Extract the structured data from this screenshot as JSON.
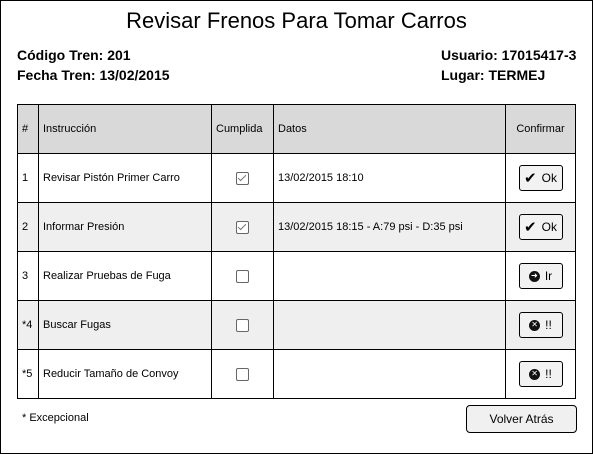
{
  "title": "Revisar Frenos Para Tomar Carros",
  "info": {
    "codigo_tren": "Código Tren: 201",
    "fecha_tren": "Fecha Tren: 13/02/2015",
    "usuario": "Usuario: 17015417-3",
    "lugar": "Lugar: TERMEJ"
  },
  "table": {
    "headers": [
      "#",
      "Instrucción",
      "Cumplida",
      "Datos",
      "Confirmar"
    ],
    "rows": [
      {
        "num": "1",
        "instruccion": "Revisar Pistón Primer Carro",
        "cumplida": true,
        "datos": "13/02/2015 18:10",
        "button": {
          "label": "Ok",
          "icon": "check-icon"
        }
      },
      {
        "num": "2",
        "instruccion": "Informar Presión",
        "cumplida": true,
        "datos": "13/02/2015 18:15 - A:79 psi - D:35 psi",
        "button": {
          "label": "Ok",
          "icon": "check-icon"
        }
      },
      {
        "num": "3",
        "instruccion": "Realizar Pruebas de Fuga",
        "cumplida": false,
        "datos": "",
        "button": {
          "label": "Ir",
          "icon": "arrow-circle-icon"
        }
      },
      {
        "num": "*4",
        "instruccion": "Buscar Fugas",
        "cumplida": false,
        "datos": "",
        "button": {
          "label": "!!",
          "icon": "x-circle-icon"
        }
      },
      {
        "num": "*5",
        "instruccion": "Reducir Tamaño de Convoy",
        "cumplida": false,
        "datos": "",
        "button": {
          "label": "!!",
          "icon": "x-circle-icon"
        }
      }
    ]
  },
  "footnote": "* Excepcional",
  "back_button": "Volver Atrás"
}
